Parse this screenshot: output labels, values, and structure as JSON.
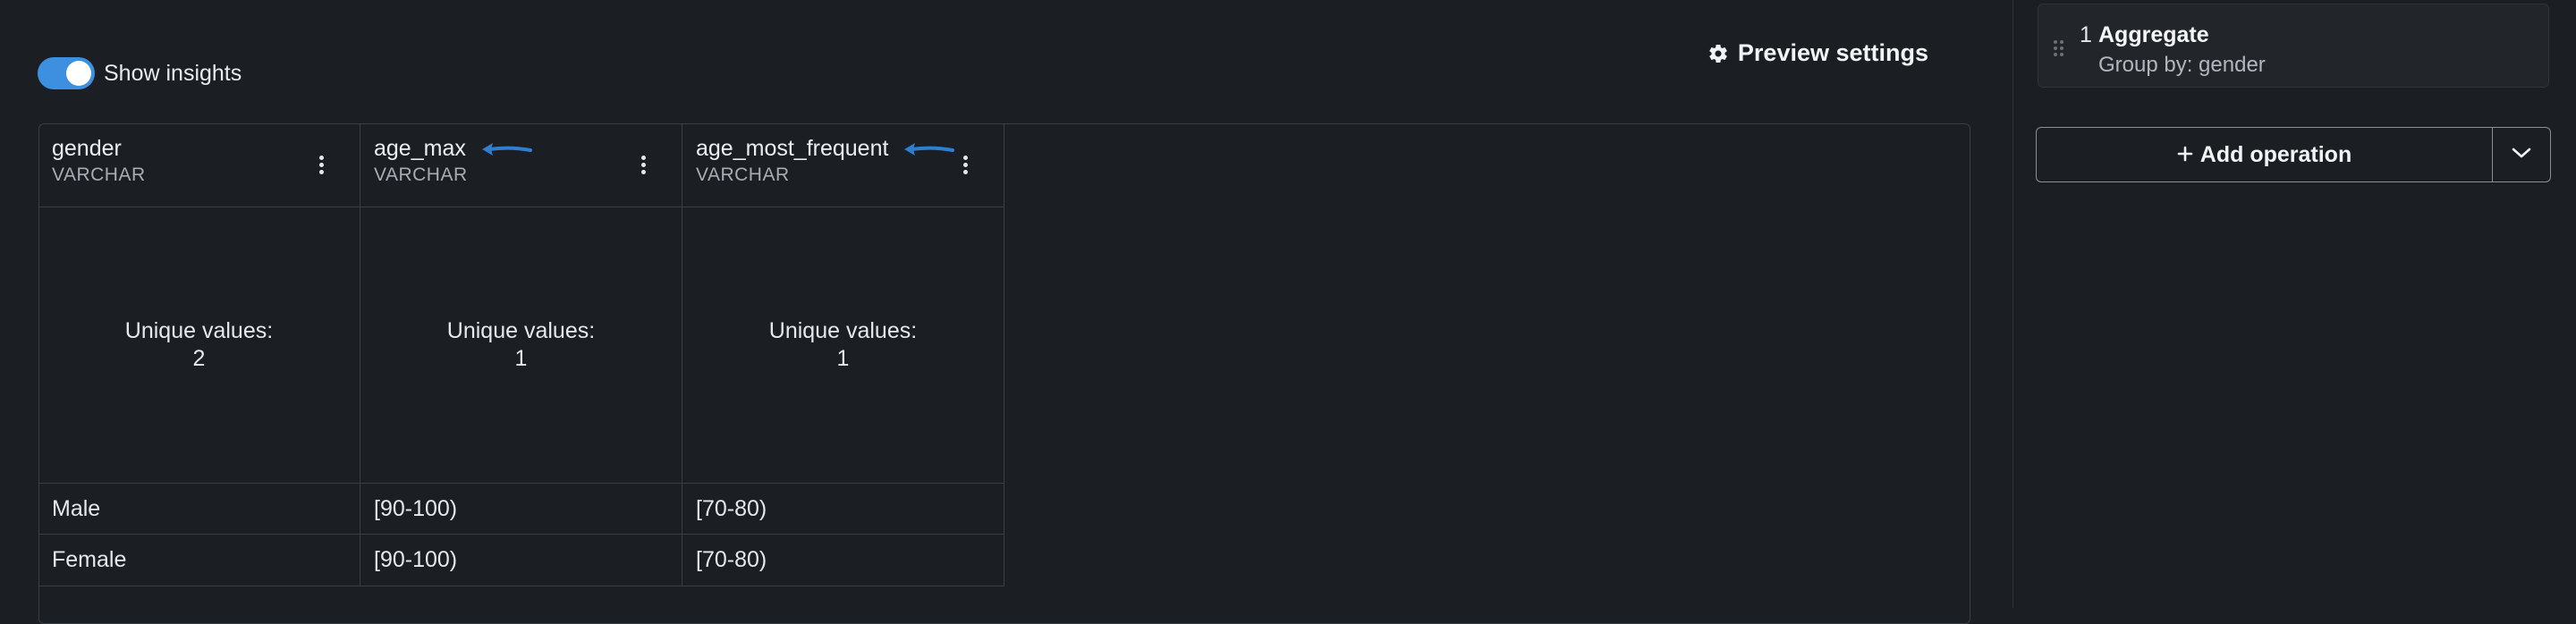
{
  "toolbar": {
    "show_insights_label": "Show insights",
    "show_insights_on": true,
    "preview_settings_label": "Preview settings",
    "preview_settings_icon": "gear-icon"
  },
  "table": {
    "columns": [
      {
        "name": "gender",
        "type": "VARCHAR",
        "unique_label": "Unique values:",
        "unique_count": "2",
        "annotated": false
      },
      {
        "name": "age_max",
        "type": "VARCHAR",
        "unique_label": "Unique values:",
        "unique_count": "1",
        "annotated": true
      },
      {
        "name": "age_most_frequent",
        "type": "VARCHAR",
        "unique_label": "Unique values:",
        "unique_count": "1",
        "annotated": true
      }
    ],
    "rows": [
      [
        "Male",
        "[90-100)",
        "[70-80)"
      ],
      [
        "Female",
        "[90-100)",
        "[70-80)"
      ]
    ]
  },
  "operations": {
    "items": [
      {
        "number": "1",
        "title": "Aggregate",
        "subtitle": "Group by: gender"
      }
    ],
    "add_label": "Add operation"
  },
  "colors": {
    "background": "#1b1e22",
    "toggle_accent": "#3d8fe0",
    "annotation_arrow": "#2f7fd1",
    "border": "#3a3f45"
  }
}
